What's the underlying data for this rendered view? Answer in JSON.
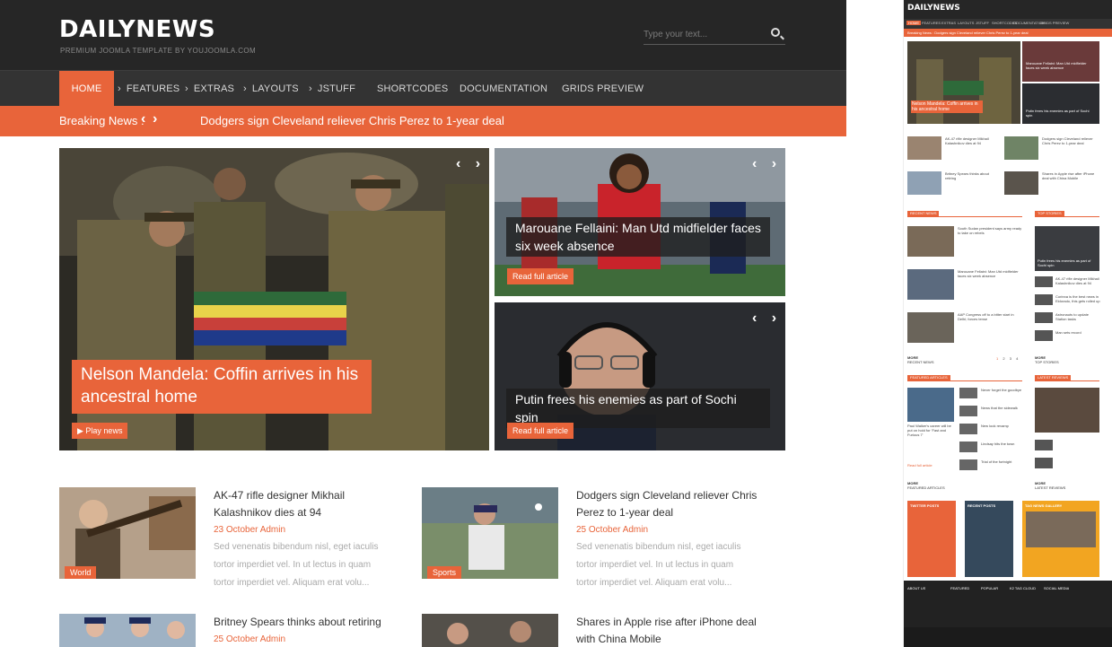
{
  "brand": {
    "logo": "DAILYNEWS",
    "tagline": "PREMIUM JOOMLA TEMPLATE BY YOUJOOMLA.COM",
    "accent": "#e8643a",
    "header_bg": "#262626",
    "nav_bg": "#333333"
  },
  "search": {
    "placeholder": "Type your text..."
  },
  "nav": {
    "items": [
      {
        "label": "HOME"
      },
      {
        "label": "FEATURES"
      },
      {
        "label": "EXTRAS"
      },
      {
        "label": "LAYOUTS"
      },
      {
        "label": "JSTUFF"
      },
      {
        "label": "SHORTCODES"
      },
      {
        "label": "DOCUMENTATION"
      },
      {
        "label": "GRIDS PREVIEW"
      }
    ],
    "icons": [
      "chevron-right-icon"
    ]
  },
  "breaking": {
    "label": "Breaking News :",
    "headline": "Dodgers sign Cleveland reliever Chris Perez to 1-year deal",
    "arrows": [
      "‹",
      "›"
    ]
  },
  "slides": [
    {
      "title": "Nelson Mandela: Coffin arrives in his ancestral home",
      "button": "Play news"
    },
    {
      "title": "Marouane Fellaini: Man Utd midfielder faces six week absence",
      "button": "Read full article"
    },
    {
      "title": "Putin frees his enemies as part of Sochi spin",
      "button": "Read full article"
    }
  ],
  "slide_controls": "‹ ›",
  "articles": [
    {
      "title": "AK-47 rifle designer Mikhail Kalashnikov dies at 94",
      "meta": "23 October  Admin",
      "excerpt": "Sed venenatis bibendum nisl, eget iaculis tortor imperdiet vel. In ut lectus in quam tortor imperdiet vel. Aliquam erat volu...",
      "category": "World"
    },
    {
      "title": "Dodgers sign Cleveland reliever Chris Perez to 1-year deal",
      "meta": "25 October  Admin",
      "excerpt": "Sed venenatis bibendum nisl, eget iaculis tortor imperdiet vel. In ut lectus in quam tortor imperdiet vel. Aliquam erat volu...",
      "category": "Sports"
    },
    {
      "title": "Britney Spears thinks about retiring",
      "meta": "25 October  Admin"
    },
    {
      "title": "Shares in Apple rise after iPhone deal with China Mobile"
    }
  ],
  "mini": {
    "logo": "DAILYNEWS",
    "nav": [
      "HOME",
      "FEATURES",
      "EXTRAS",
      "LAYOUTS",
      "JSTUFF",
      "SHORTCODES",
      "DOCUMENTATION",
      "GRIDS PREVIEW"
    ],
    "breaking": "Breaking News :   Dodgers sign Cleveland reliever Chris Perez to 1-year deal",
    "slide_title": "Nelson Mandela: Coffin arrives in his ancestral home",
    "side1": "Marouane Fellaini: Man Utd midfielder faces six week absence",
    "side2": "Putin frees his enemies as part of Sochi spin",
    "grid": [
      "AK-47 rifle designer Mikhail Kalashnikov dies at 94",
      "Dodgers sign Cleveland reliever Chris Perez to 1-year deal",
      "Britney Spears thinks about retiring",
      "Shares in Apple rise after iPhone deal with China Mobile"
    ],
    "recent_news": "RECENT NEWS",
    "top_stories": "TOP STORIES",
    "recent": [
      "South Sudan president says army ready to take on rebels",
      "Marouane Fellaini: Man Utd midfielder faces six week absence",
      "AAP Congress off to a bitter start in Delhi; forces tense"
    ],
    "top_card": "Putin frees his enemies as part of Sochi spin",
    "top_list": [
      "AK-47 rifle designer Mikhail Kalashnikov dies at 94",
      "Corinna is the best news in Eldorado, this gets rolled up",
      "Astronauts to update Station tasks",
      "Man sets record"
    ],
    "more": "MORE",
    "more_recent": "RECENT NEWS",
    "more_top": "TOP STORIES",
    "pages": [
      "1",
      "2",
      "3",
      "4"
    ],
    "featured_articles": "FEATURED ARTICLES",
    "latest_reviews": "LATEST REVIEWS",
    "feat_card": "Paul Walker's career will be put on hold for 'Fast and Furious 7'",
    "feat_list": [
      "Never forget the goodbye",
      "News that the sidewalk",
      "New look revamp",
      "Lindsay hits the town",
      "Trial of the fortnight"
    ],
    "more_feat": "FEATURED ARTICLES",
    "more_latest": "LATEST REVIEWS",
    "twitter": "TWITTER POSTS",
    "recent_posts": "RECENT POSTS",
    "gallery": "TAG NEWS GALLERY",
    "footer": [
      "ABOUT US",
      "FEATURED",
      "POPULAR",
      "K2 TAG CLOUD",
      "SOCIAL MEDIA"
    ],
    "read": "Read full article"
  }
}
